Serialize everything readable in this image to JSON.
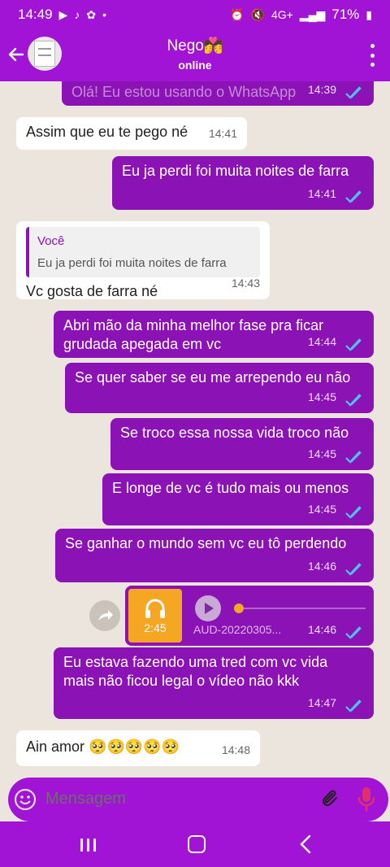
{
  "status_bar": {
    "time": "14:49",
    "battery": "71%",
    "network": "4G+"
  },
  "header": {
    "contact_name": "Nego💏",
    "contact_status": "online"
  },
  "messages": [
    {
      "type": "out",
      "text": "Olá! Eu estou usando o WhatsApp",
      "time": "14:39"
    },
    {
      "type": "in",
      "text": "Assim que eu te pego né",
      "time": "14:41"
    },
    {
      "type": "out",
      "text": "Eu ja perdi foi muita noites de farra",
      "time": "14:41"
    },
    {
      "type": "in",
      "quote_author": "Você",
      "quote_text": "Eu ja perdi foi muita noites de farra",
      "text": "Vc gosta de farra né",
      "time": "14:43"
    },
    {
      "type": "out",
      "text": "Abri mão da minha melhor fase pra ficar\ngrudada apegada em vc",
      "time": "14:44"
    },
    {
      "type": "out",
      "text": "Se quer saber se eu me arrependo eu não",
      "time": "14:45"
    },
    {
      "type": "out",
      "text": "Se troco essa nossa vida troco não",
      "time": "14:45"
    },
    {
      "type": "out",
      "text": "E longe de vc é tudo mais ou menos",
      "time": "14:45"
    },
    {
      "type": "out",
      "text": "Se ganhar o mundo sem vc eu tô perdendo",
      "time": "14:46"
    },
    {
      "type": "audio",
      "duration": "2:45",
      "filename": "AUD-20220305...",
      "time": "14:46"
    },
    {
      "type": "out",
      "text": "Eu estava fazendo uma tred com vc vida\nmais não ficou legal o vídeo não kkk",
      "time": "14:47"
    },
    {
      "type": "in",
      "text": "Ain amor 🥺🥺🥺🥺🥺",
      "time": "14:48"
    }
  ],
  "input": {
    "placeholder": "Mensagem"
  },
  "colors": {
    "accent": "#a114d6",
    "bubble_out": "#8b12b4",
    "bubble_in": "#ffffff",
    "tick": "#4fc3f7"
  }
}
